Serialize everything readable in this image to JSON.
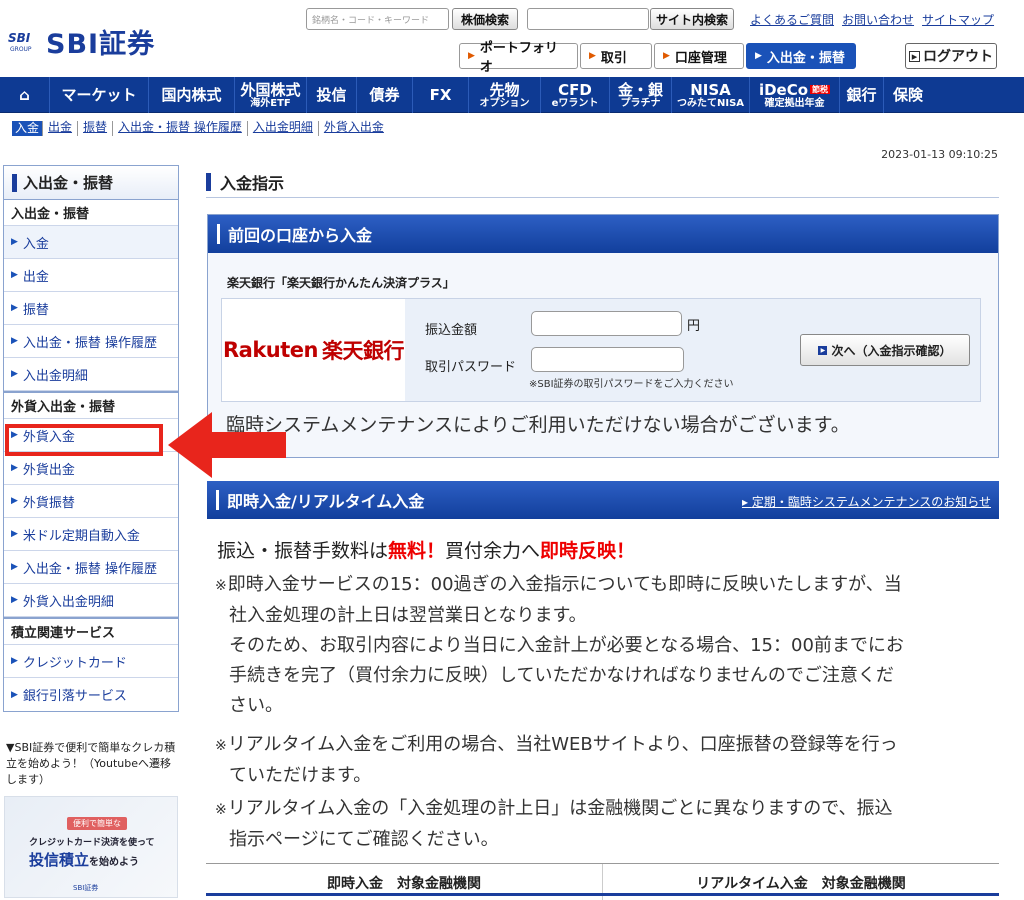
{
  "header": {
    "logo_group": "SBI",
    "logo_sub": "GROUP",
    "logo_text": "SBI証券",
    "stock_search_placeholder": "銘柄名・コード・キーワード",
    "stock_search_button": "株価検索",
    "site_search_button": "サイト内検索",
    "links": [
      "よくあるご質問",
      "お問い合わせ",
      "サイトマップ"
    ],
    "pills": [
      "ポートフォリオ",
      "取引",
      "口座管理",
      "入出金・振替"
    ],
    "logout": "ログアウト"
  },
  "nav": [
    {
      "l1": "⌂",
      "l2": ""
    },
    {
      "l1": "マーケット",
      "l2": ""
    },
    {
      "l1": "国内株式",
      "l2": ""
    },
    {
      "l1": "外国株式",
      "l2": "海外ETF"
    },
    {
      "l1": "投信",
      "l2": ""
    },
    {
      "l1": "債券",
      "l2": ""
    },
    {
      "l1": "FX",
      "l2": ""
    },
    {
      "l1": "先物",
      "l2": "オプション"
    },
    {
      "l1": "CFD",
      "l2": "eワラント"
    },
    {
      "l1": "金・銀",
      "l2": "プラチナ"
    },
    {
      "l1": "NISA",
      "l2": "つみたてNISA"
    },
    {
      "l1": "iDeCo",
      "l2": "確定拠出年金",
      "badge": "節税"
    },
    {
      "l1": "銀行",
      "l2": ""
    },
    {
      "l1": "保険",
      "l2": ""
    }
  ],
  "subnav": [
    "入金",
    "出金",
    "振替",
    "入出金・振替 操作履歴",
    "入出金明細",
    "外貨入出金"
  ],
  "timestamp": "2023-01-13 09:10:25",
  "sidebar": {
    "title": "入出金・振替",
    "sec1": "入出金・振替",
    "items1": [
      "入金",
      "出金",
      "振替",
      "入出金・振替 操作履歴",
      "入出金明細"
    ],
    "sec2": "外貨入出金・振替",
    "items2": [
      "外貨入金",
      "外貨出金",
      "外貨振替",
      "米ドル定期自動入金",
      "入出金・振替 操作履歴",
      "外貨入出金明細"
    ],
    "sec3": "積立関連サービス",
    "items3": [
      "クレジットカード",
      "銀行引落サービス"
    ]
  },
  "promo": {
    "text": "▼SBI証券で便利で簡単なクレカ積立を始めよう！（Youtubeへ遷移します）",
    "badge": "便利で簡単な",
    "line1": "クレジットカード決済を使って",
    "line2a": "投信積立",
    "line2b": "を始めよう",
    "brand": "SBI証券"
  },
  "main": {
    "title": "入金指示",
    "panel1_title": "前回の口座から入金",
    "bank_name": "楽天銀行「楽天銀行かんたん決済プラス」",
    "bank_logo_en": "Rakuten",
    "bank_logo_jp": "楽天銀行",
    "amount_label": "振込金額",
    "amount_unit": "円",
    "password_label": "取引パスワード",
    "password_note": "※SBI証券の取引パスワードをご入力ください",
    "next_button": "次へ（入金指示確認）",
    "maintenance": "臨時システムメンテナンスによりご利用いただけない場合がございます。",
    "panel2_title": "即時入金/リアルタイム入金",
    "panel2_link": "定期・臨時システムメンテナンスのお知らせ",
    "fee_a": "振込・振替手数料は",
    "fee_b": "無料！",
    "fee_c": "買付余力へ",
    "fee_d": "即時反映！",
    "notes": [
      {
        "l1": "即時入金サービスの15：00過ぎの入金指示についても即時に反映いたしますが、当",
        "l2": "社入金処理の計上日は翌営業日となります。",
        "l3": "そのため、お取引内容により当日に入金計上が必要となる場合、15：00前までにお",
        "l4": "手続きを完了（買付余力に反映）していただかなければなりませんのでご注意くだ",
        "l5": "さい。"
      },
      {
        "l1": "リアルタイム入金をご利用の場合、当社WEBサイトより、口座振替の登録等を行っ",
        "l2": "ていただけます。"
      },
      {
        "l1": "リアルタイム入金の「入金処理の計上日」は金融機関ごとに異なりますので、振込",
        "l2": "指示ページにてご確認ください。"
      }
    ],
    "table_headers": [
      "即時入金　対象金融機関",
      "リアルタイム入金　対象金融機関"
    ]
  },
  "colors": {
    "brand": "#1a3d9c",
    "nav": "#0e3a93",
    "accent": "#e8251c",
    "rakuten": "#bf0000"
  }
}
